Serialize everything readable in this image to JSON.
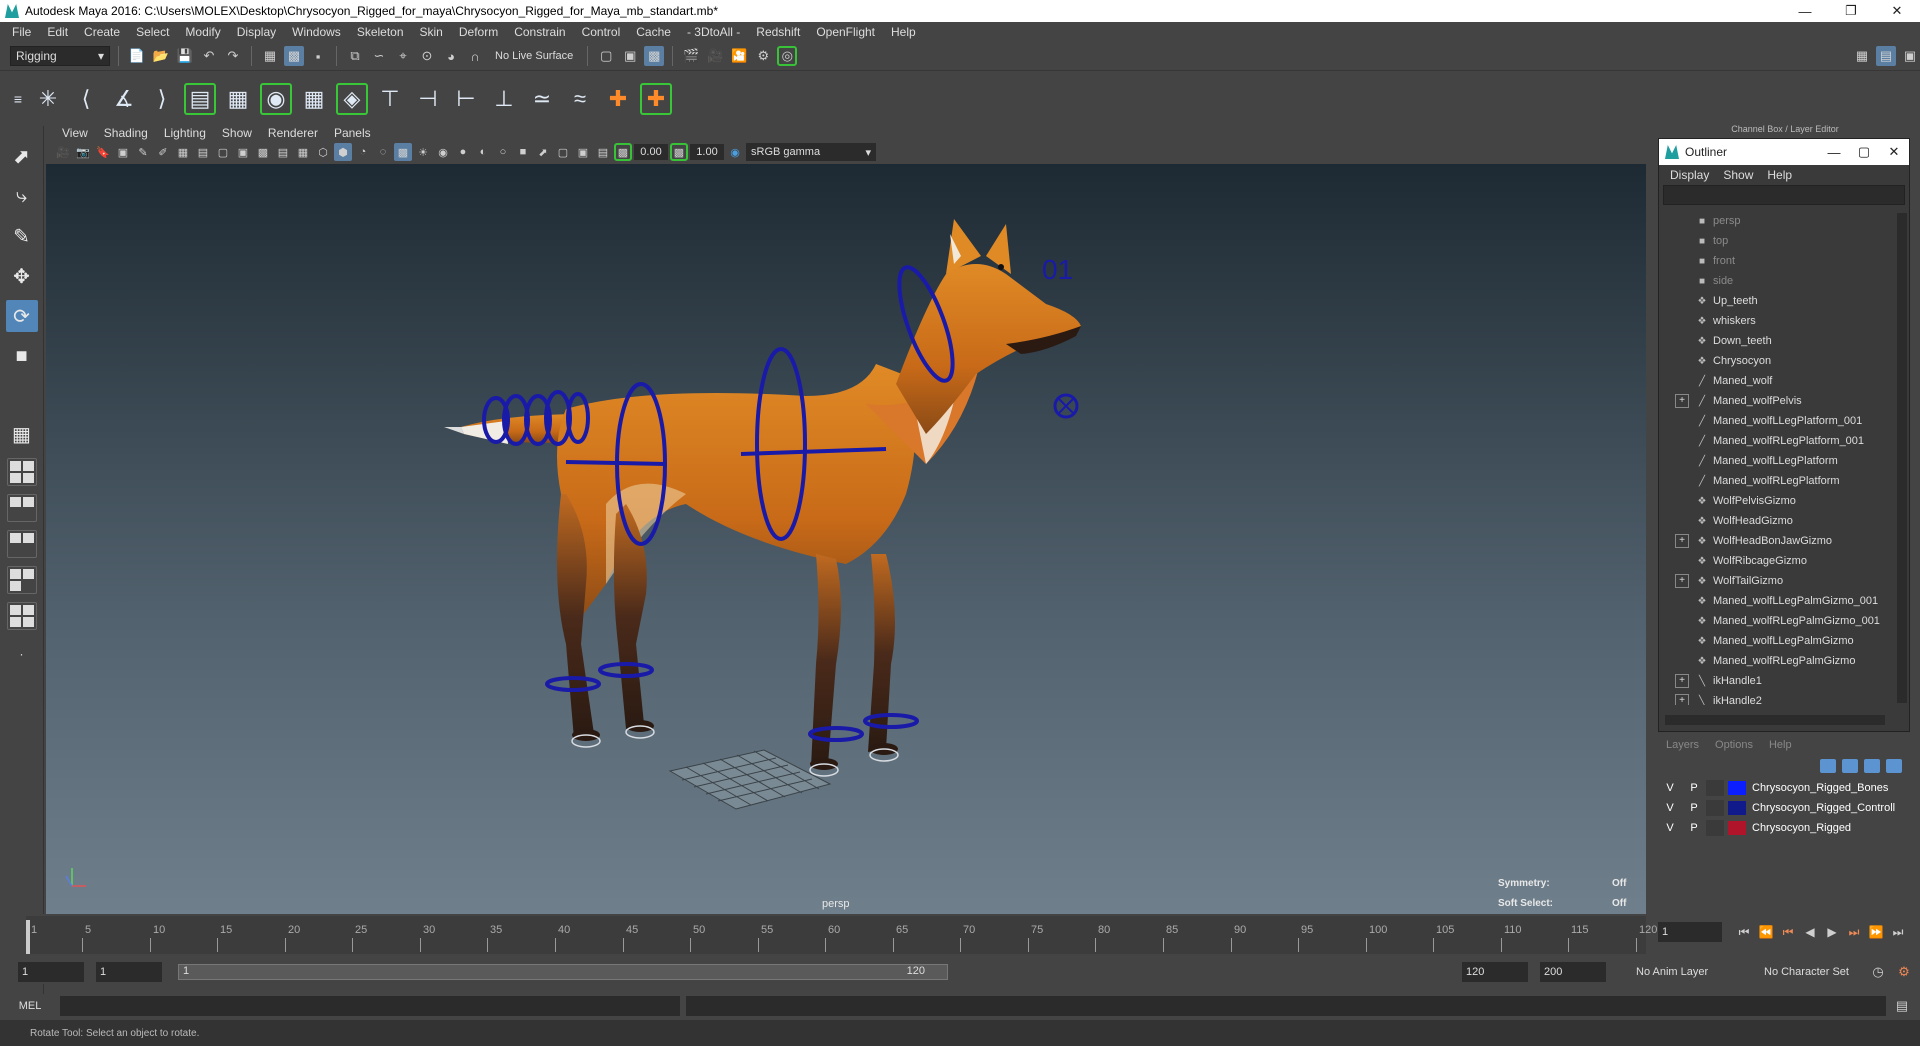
{
  "window": {
    "title": "Autodesk Maya 2016: C:\\Users\\MOLEX\\Desktop\\Chrysocyon_Rigged_for_maya\\Chrysocyon_Rigged_for_Maya_mb_standart.mb*"
  },
  "menubar": [
    "File",
    "Edit",
    "Create",
    "Select",
    "Modify",
    "Display",
    "Windows",
    "Skeleton",
    "Skin",
    "Deform",
    "Constrain",
    "Control",
    "Cache",
    "- 3DtoAll -",
    "Redshift",
    "OpenFlight",
    "Help"
  ],
  "status": {
    "mode": "Rigging",
    "live_surface": "No Live Surface"
  },
  "panel": {
    "menu": [
      "View",
      "Shading",
      "Lighting",
      "Show",
      "Renderer",
      "Panels"
    ],
    "exposure": "0.00",
    "gamma": "1.00",
    "color_space": "sRGB gamma"
  },
  "viewport": {
    "camera": "persp",
    "symmetry_label": "Symmetry:",
    "symmetry_value": "Off",
    "soft_select_label": "Soft Select:",
    "soft_select_value": "Off",
    "ctrl_label": "01"
  },
  "rightpanel": {
    "channel_box_title": "Channel Box / Layer Editor"
  },
  "outliner": {
    "title": "Outliner",
    "menu": [
      "Display",
      "Show",
      "Help"
    ],
    "items": [
      {
        "label": "persp",
        "icon": "camera-icon",
        "cam": true,
        "expand": false
      },
      {
        "label": "top",
        "icon": "camera-icon",
        "cam": true,
        "expand": false
      },
      {
        "label": "front",
        "icon": "camera-icon",
        "cam": true,
        "expand": false
      },
      {
        "label": "side",
        "icon": "camera-icon",
        "cam": true,
        "expand": false
      },
      {
        "label": "Up_teeth",
        "icon": "mesh-icon",
        "cam": false,
        "expand": false
      },
      {
        "label": "whiskers",
        "icon": "mesh-icon",
        "cam": false,
        "expand": false
      },
      {
        "label": "Down_teeth",
        "icon": "mesh-icon",
        "cam": false,
        "expand": false
      },
      {
        "label": "Chrysocyon",
        "icon": "mesh-icon",
        "cam": false,
        "expand": false
      },
      {
        "label": "Maned_wolf",
        "icon": "joint-icon",
        "cam": false,
        "expand": false
      },
      {
        "label": "Maned_wolfPelvis",
        "icon": "joint-icon",
        "cam": false,
        "expand": true
      },
      {
        "label": "Maned_wolfLLegPlatform_001",
        "icon": "joint-icon",
        "cam": false,
        "expand": false
      },
      {
        "label": "Maned_wolfRLegPlatform_001",
        "icon": "joint-icon",
        "cam": false,
        "expand": false
      },
      {
        "label": "Maned_wolfLLegPlatform",
        "icon": "joint-icon",
        "cam": false,
        "expand": false
      },
      {
        "label": "Maned_wolfRLegPlatform",
        "icon": "joint-icon",
        "cam": false,
        "expand": false
      },
      {
        "label": "WolfPelvisGizmo",
        "icon": "mesh-icon",
        "cam": false,
        "expand": false
      },
      {
        "label": "WolfHeadGizmo",
        "icon": "mesh-icon",
        "cam": false,
        "expand": false
      },
      {
        "label": "WolfHeadBonJawGizmo",
        "icon": "mesh-icon",
        "cam": false,
        "expand": true
      },
      {
        "label": "WolfRibcageGizmo",
        "icon": "mesh-icon",
        "cam": false,
        "expand": false
      },
      {
        "label": "WolfTailGizmo",
        "icon": "mesh-icon",
        "cam": false,
        "expand": true
      },
      {
        "label": "Maned_wolfLLegPalmGizmo_001",
        "icon": "mesh-icon",
        "cam": false,
        "expand": false
      },
      {
        "label": "Maned_wolfRLegPalmGizmo_001",
        "icon": "mesh-icon",
        "cam": false,
        "expand": false
      },
      {
        "label": "Maned_wolfLLegPalmGizmo",
        "icon": "mesh-icon",
        "cam": false,
        "expand": false
      },
      {
        "label": "Maned_wolfRLegPalmGizmo",
        "icon": "mesh-icon",
        "cam": false,
        "expand": false
      },
      {
        "label": "ikHandle1",
        "icon": "ik-icon",
        "cam": false,
        "expand": true
      },
      {
        "label": "ikHandle2",
        "icon": "ik-icon",
        "cam": false,
        "expand": true
      }
    ]
  },
  "layers": {
    "menu": [
      "Layers",
      "Options",
      "Help"
    ],
    "rows": [
      {
        "v": "V",
        "p": "P",
        "color": "#0a1eff",
        "name": "Chrysocyon_Rigged_Bones"
      },
      {
        "v": "V",
        "p": "P",
        "color": "#101a8a",
        "name": "Chrysocyon_Rigged_Controll"
      },
      {
        "v": "V",
        "p": "P",
        "color": "#b0142a",
        "name": "Chrysocyon_Rigged"
      }
    ]
  },
  "timeline": {
    "ticks": [
      1,
      5,
      10,
      15,
      20,
      25,
      30,
      35,
      40,
      45,
      50,
      55,
      60,
      65,
      70,
      75,
      80,
      85,
      90,
      95,
      100,
      105,
      110,
      115,
      120
    ],
    "current": "1"
  },
  "range": {
    "start": "1",
    "anim_start": "1",
    "slider_start": "1",
    "slider_end": "120",
    "end": "120",
    "anim_end": "200",
    "anim_layer": "No Anim Layer",
    "char_set": "No Character Set"
  },
  "cmd": {
    "label": "MEL"
  },
  "help": {
    "text": "Rotate Tool: Select an object to rotate."
  }
}
